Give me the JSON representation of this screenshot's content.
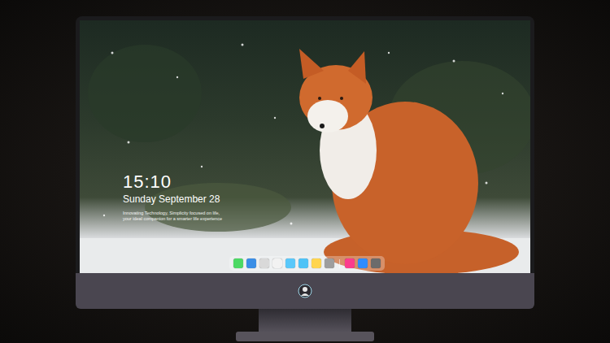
{
  "lock_screen": {
    "time": "15:10",
    "date": "Sunday September 28",
    "tagline": [
      "Innovating Technology, Simplicity focused on life,",
      "your ideal companion for a smarter life experience"
    ]
  },
  "dock": {
    "apps": [
      {
        "color": "#4cd964"
      },
      {
        "color": "#3a8ee6"
      },
      {
        "color": "#d9d9d9"
      },
      {
        "color": "#f2f2f2"
      },
      {
        "color": "#5ac8fa"
      },
      {
        "color": "#4fc3f7"
      },
      {
        "color": "#ffd54f"
      },
      {
        "color": "#9e9e9e"
      },
      {
        "color": "#fc3c8d"
      },
      {
        "color": "#2f8cff"
      },
      {
        "color": "#6b6b6b"
      }
    ]
  }
}
